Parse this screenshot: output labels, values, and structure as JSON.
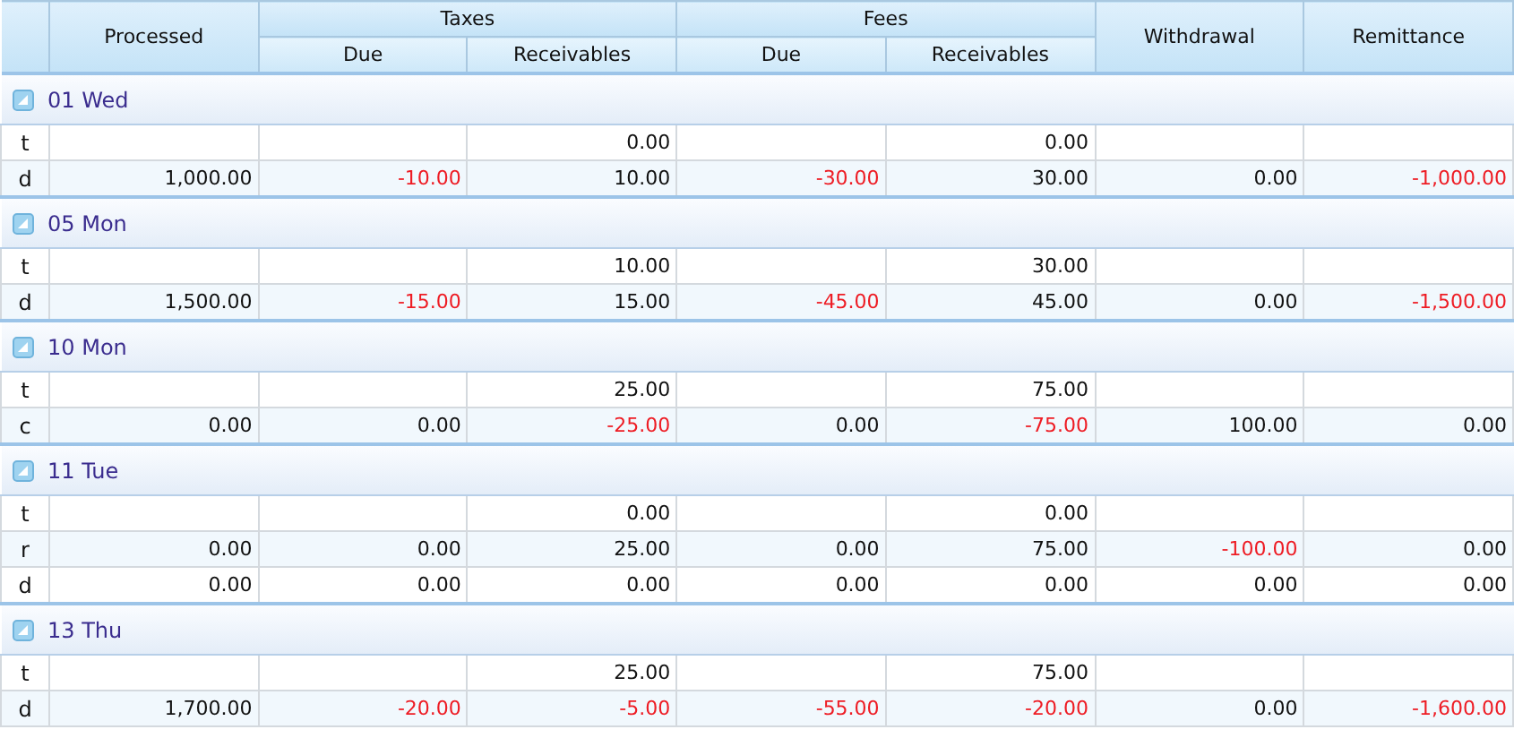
{
  "table": {
    "columns": [
      {
        "label": "Processed"
      },
      {
        "label": "Taxes",
        "children": [
          {
            "label": "Due"
          },
          {
            "label": "Receivables"
          }
        ]
      },
      {
        "label": "Fees",
        "children": [
          {
            "label": "Due"
          },
          {
            "label": "Receivables"
          }
        ]
      },
      {
        "label": "Withdrawal"
      },
      {
        "label": "Remittance"
      }
    ],
    "groups": [
      {
        "label": "01 Wed",
        "expanded": true,
        "rows": [
          {
            "label": "t",
            "cells": [
              null,
              null,
              {
                "value": "0.00",
                "negative": false
              },
              null,
              {
                "value": "0.00",
                "negative": false
              },
              null,
              null
            ]
          },
          {
            "label": "d",
            "cells": [
              {
                "value": "1,000.00",
                "negative": false
              },
              {
                "value": "-10.00",
                "negative": true
              },
              {
                "value": "10.00",
                "negative": false
              },
              {
                "value": "-30.00",
                "negative": true
              },
              {
                "value": "30.00",
                "negative": false
              },
              {
                "value": "0.00",
                "negative": false
              },
              {
                "value": "-1,000.00",
                "negative": true
              }
            ]
          }
        ]
      },
      {
        "label": "05 Mon",
        "expanded": true,
        "rows": [
          {
            "label": "t",
            "cells": [
              null,
              null,
              {
                "value": "10.00",
                "negative": false
              },
              null,
              {
                "value": "30.00",
                "negative": false
              },
              null,
              null
            ]
          },
          {
            "label": "d",
            "cells": [
              {
                "value": "1,500.00",
                "negative": false
              },
              {
                "value": "-15.00",
                "negative": true
              },
              {
                "value": "15.00",
                "negative": false
              },
              {
                "value": "-45.00",
                "negative": true
              },
              {
                "value": "45.00",
                "negative": false
              },
              {
                "value": "0.00",
                "negative": false
              },
              {
                "value": "-1,500.00",
                "negative": true
              }
            ]
          }
        ]
      },
      {
        "label": "10 Mon",
        "expanded": true,
        "rows": [
          {
            "label": "t",
            "cells": [
              null,
              null,
              {
                "value": "25.00",
                "negative": false
              },
              null,
              {
                "value": "75.00",
                "negative": false
              },
              null,
              null
            ]
          },
          {
            "label": "c",
            "cells": [
              {
                "value": "0.00",
                "negative": false
              },
              {
                "value": "0.00",
                "negative": false
              },
              {
                "value": "-25.00",
                "negative": true
              },
              {
                "value": "0.00",
                "negative": false
              },
              {
                "value": "-75.00",
                "negative": true
              },
              {
                "value": "100.00",
                "negative": false
              },
              {
                "value": "0.00",
                "negative": false
              }
            ]
          }
        ]
      },
      {
        "label": "11 Tue",
        "expanded": true,
        "rows": [
          {
            "label": "t",
            "cells": [
              null,
              null,
              {
                "value": "0.00",
                "negative": false
              },
              null,
              {
                "value": "0.00",
                "negative": false
              },
              null,
              null
            ]
          },
          {
            "label": "r",
            "cells": [
              {
                "value": "0.00",
                "negative": false
              },
              {
                "value": "0.00",
                "negative": false
              },
              {
                "value": "25.00",
                "negative": false
              },
              {
                "value": "0.00",
                "negative": false
              },
              {
                "value": "75.00",
                "negative": false
              },
              {
                "value": "-100.00",
                "negative": true
              },
              {
                "value": "0.00",
                "negative": false
              }
            ]
          },
          {
            "label": "d",
            "cells": [
              {
                "value": "0.00",
                "negative": false
              },
              {
                "value": "0.00",
                "negative": false
              },
              {
                "value": "0.00",
                "negative": false
              },
              {
                "value": "0.00",
                "negative": false
              },
              {
                "value": "0.00",
                "negative": false
              },
              {
                "value": "0.00",
                "negative": false
              },
              {
                "value": "0.00",
                "negative": false
              }
            ]
          }
        ]
      },
      {
        "label": "13 Thu",
        "expanded": true,
        "rows": [
          {
            "label": "t",
            "cells": [
              null,
              null,
              {
                "value": "25.00",
                "negative": false
              },
              null,
              {
                "value": "75.00",
                "negative": false
              },
              null,
              null
            ]
          },
          {
            "label": "d",
            "cells": [
              {
                "value": "1,700.00",
                "negative": false
              },
              {
                "value": "-20.00",
                "negative": true
              },
              {
                "value": "-5.00",
                "negative": true
              },
              {
                "value": "-55.00",
                "negative": true
              },
              {
                "value": "-20.00",
                "negative": true
              },
              {
                "value": "0.00",
                "negative": false
              },
              {
                "value": "-1,600.00",
                "negative": true
              }
            ]
          }
        ]
      }
    ]
  }
}
